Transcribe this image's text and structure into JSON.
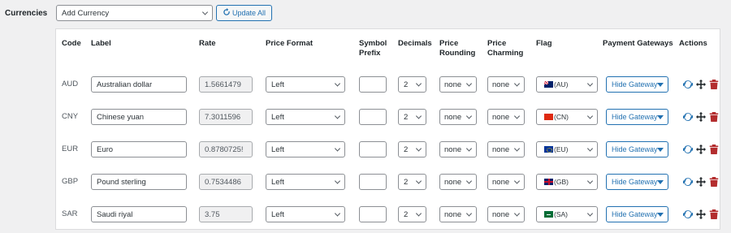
{
  "section_label": "Currencies",
  "add_currency": {
    "value": "Add Currency"
  },
  "update_button": {
    "label": "Update All",
    "icon": "refresh-icon"
  },
  "headers": {
    "code": "Code",
    "label": "Label",
    "rate": "Rate",
    "price_format": "Price Format",
    "symbol_prefix": "Symbol Prefix",
    "decimals": "Decimals",
    "price_rounding": "Price Rounding",
    "price_charming": "Price Charming",
    "flag": "Flag",
    "payment_gateways": "Payment Gateways",
    "actions": "Actions"
  },
  "rows": [
    {
      "code": "AUD",
      "label": "Australian dollar",
      "rate": "1.5661479",
      "price_format": "Left",
      "symbol_prefix": "",
      "decimals": "2",
      "rounding": "none",
      "charming": "none",
      "flag_code": "(AU)",
      "gateway": "Hide Gateway"
    },
    {
      "code": "CNY",
      "label": "Chinese yuan",
      "rate": "7.3011596",
      "price_format": "Left",
      "symbol_prefix": "",
      "decimals": "2",
      "rounding": "none",
      "charming": "none",
      "flag_code": "(CN)",
      "gateway": "Hide Gateway"
    },
    {
      "code": "EUR",
      "label": "Euro",
      "rate": "0.8780725!",
      "price_format": "Left",
      "symbol_prefix": "",
      "decimals": "2",
      "rounding": "none",
      "charming": "none",
      "flag_code": "(EU)",
      "gateway": "Hide Gateway"
    },
    {
      "code": "GBP",
      "label": "Pound sterling",
      "rate": "0.7534486",
      "price_format": "Left",
      "symbol_prefix": "",
      "decimals": "2",
      "rounding": "none",
      "charming": "none",
      "flag_code": "(GB)",
      "gateway": "Hide Gateway"
    },
    {
      "code": "SAR",
      "label": "Saudi riyal",
      "rate": "3.75",
      "price_format": "Left",
      "symbol_prefix": "",
      "decimals": "2",
      "rounding": "none",
      "charming": "none",
      "flag_code": "(SA)",
      "gateway": "Hide Gateway"
    }
  ],
  "icons": {
    "sync": "sync-icon",
    "move": "move-icon",
    "delete": "trash-icon"
  },
  "colors": {
    "accent": "#2271b1",
    "delete": "#b32d2e",
    "sync": "#2271b1"
  }
}
